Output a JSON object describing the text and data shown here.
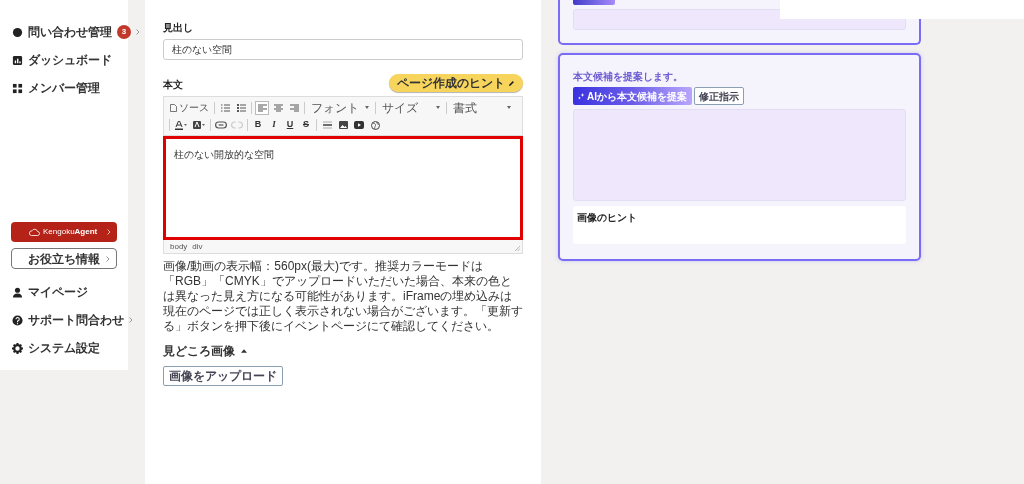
{
  "sidebar": {
    "items": [
      {
        "kind": "circle",
        "label": "問い合わせ管理",
        "badge": "3",
        "has_submenu": true
      },
      {
        "kind": "chart",
        "label": "ダッシュボード",
        "has_submenu": false
      },
      {
        "kind": "grid",
        "label": "メンバー管理",
        "has_submenu": false
      }
    ],
    "agent_button": {
      "brand": "Kengoku",
      "brand_bold": "Agent"
    },
    "info_button": "お役立ち情報",
    "bottom_items": [
      {
        "kind": "person",
        "label": "マイページ",
        "has_submenu": false
      },
      {
        "kind": "help",
        "label": "サポート問合わせ",
        "has_submenu": true
      },
      {
        "kind": "gear",
        "label": "システム設定",
        "has_submenu": false
      }
    ]
  },
  "form": {
    "heading_label": "見出し",
    "heading_value": "柱のない空間",
    "body_label": "本文",
    "hint_button": "ページ作成のヒント",
    "toolbar": {
      "source": "ソース",
      "align": [
        {
          "selected": true
        },
        {
          "selected": false
        },
        {
          "selected": false
        }
      ],
      "dropdowns": [
        {
          "label": "フォント"
        },
        {
          "label": "サイズ"
        },
        {
          "label": "書式"
        }
      ],
      "unlink_disabled": true,
      "format_buttons": [
        {
          "kind": "bold",
          "label": "B"
        },
        {
          "kind": "italic",
          "label": "I"
        },
        {
          "kind": "underline",
          "label": "U"
        },
        {
          "kind": "strike",
          "label": "S"
        }
      ]
    },
    "editor_text": "柱のない開放的な空間",
    "path": [
      "body",
      "div"
    ],
    "note": "画像/動画の表示幅：560px(最大)です。推奨カラーモードは「RGB」「CMYK」でアップロードいただいた場合、本来の色とは異なった見え方になる可能性があります。iFrameの埋め込みは現在のページでは正しく表示されない場合がございます。「更新する」ボタンを押下後にイベントページにて確認してください。",
    "gallery_title": "見どころ画像",
    "gallery_expanded": true,
    "upload_button": "画像をアップロード"
  },
  "ai_panel": {
    "title": "本文候補を提案します。",
    "suggest_button": "AIから本文候補を提案",
    "revise_button": "修正指示",
    "image_hint_label": "画像のヒント"
  }
}
